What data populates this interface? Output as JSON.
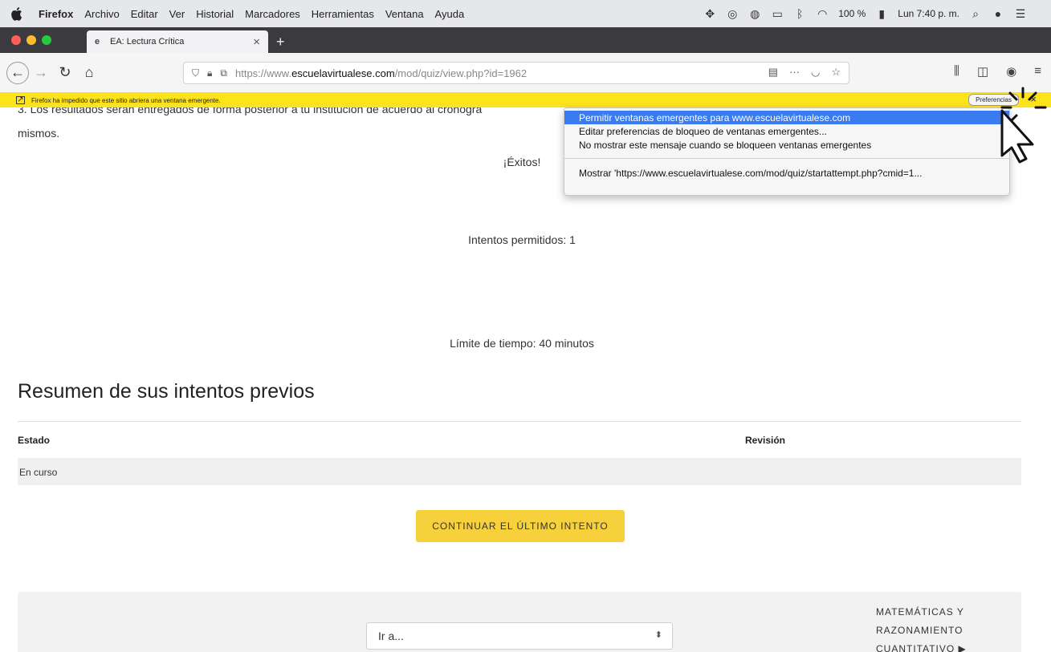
{
  "menubar": {
    "app_name": "Firefox",
    "items": [
      "Archivo",
      "Editar",
      "Ver",
      "Historial",
      "Marcadores",
      "Herramientas",
      "Ventana",
      "Ayuda"
    ],
    "battery": "100 %",
    "clock": "Lun 7:40 p. m."
  },
  "tab": {
    "title": "EA: Lectura Crítica",
    "close_icon": "×",
    "new_tab_icon": "+"
  },
  "url": {
    "scheme": "https://www.",
    "domain": "escuelavirtualese.com",
    "path": "/mod/quiz/view.php?id=1962"
  },
  "popup_bar": {
    "message": "Firefox ha impedido que este sitio abriera una ventana emergente.",
    "preferences_label": "Preferencias"
  },
  "dropdown": {
    "items": [
      "Permitir ventanas emergentes para www.escuelavirtualese.com",
      "Editar preferencias de bloqueo de ventanas emergentes...",
      "No mostrar este mensaje cuando se bloqueen ventanas emergentes",
      "Mostrar 'https://www.escuelavirtualese.com/mod/quiz/startattempt.php?cmid=1..."
    ]
  },
  "page": {
    "cut_text": "3. Los resultados serán entregados de forma posterior a tu institución de acuerdo al cronogra",
    "mismos": "mismos.",
    "exitos": "¡Éxitos!",
    "intentos": "Intentos permitidos: 1",
    "limite": "Límite de tiempo: 40 minutos",
    "summary_title": "Resumen de sus intentos previos",
    "table": {
      "headers": [
        "Estado",
        "Revisión"
      ],
      "rows": [
        [
          "En curso",
          ""
        ]
      ]
    },
    "continue_label": "CONTINUAR EL ÚLTIMO INTENTO",
    "goto_label": "Ir a...",
    "next_link": "MATEMÁTICAS Y RAZONAMIENTO CUANTITATIVO ▶"
  },
  "colors": {
    "popup_bar": "#fde31b",
    "button": "#f7d13c",
    "menu_highlight": "#3a7bf0"
  }
}
